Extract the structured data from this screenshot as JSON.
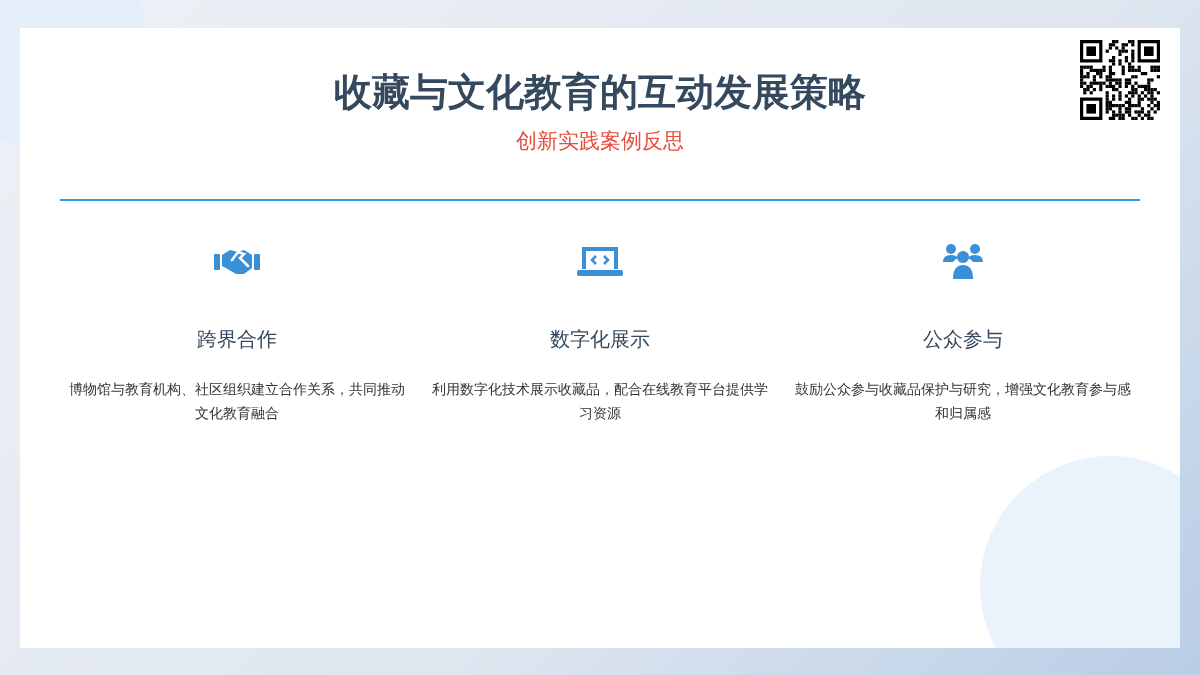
{
  "title": "收藏与文化教育的互动发展策略",
  "subtitle": "创新实践案例反思",
  "features": [
    {
      "kind": "partnership",
      "heading": "跨界合作",
      "text": "博物馆与教育机构、社区组织建立合作关系，共同推动文化教育融合"
    },
    {
      "kind": "digital",
      "heading": "数字化展示",
      "text": "利用数字化技术展示收藏品，配合在线教育平台提供学习资源"
    },
    {
      "kind": "community",
      "heading": "公众参与",
      "text": "鼓励公众参与收藏品保护与研究，增强文化教育参与感和归属感"
    }
  ]
}
